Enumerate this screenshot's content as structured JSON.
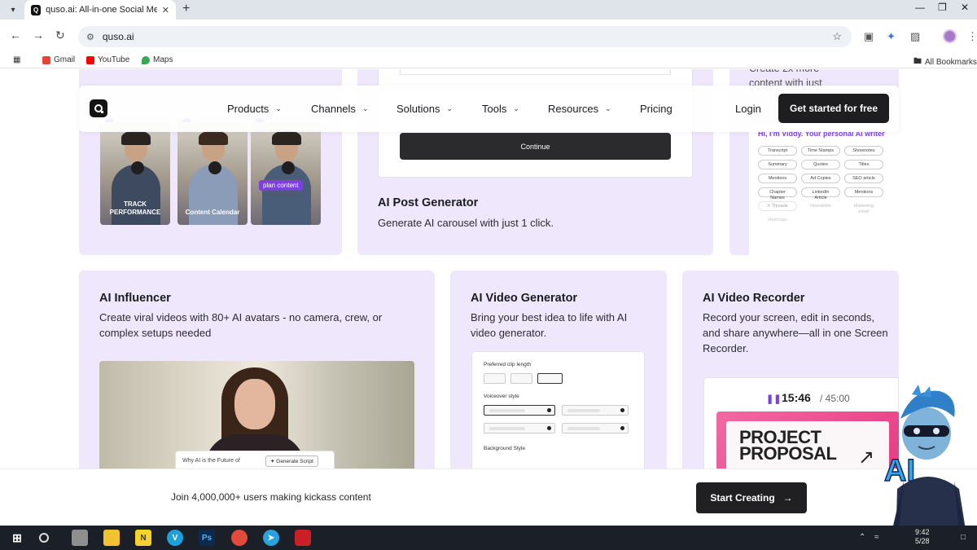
{
  "browser": {
    "tab_title": "quso.ai: All-in-one Social Media",
    "url": "quso.ai",
    "bookmarks": [
      "Gmail",
      "YouTube",
      "Maps"
    ],
    "all_bookmarks": "All Bookmarks"
  },
  "nav": {
    "items": [
      "Products",
      "Channels",
      "Solutions",
      "Tools",
      "Resources"
    ],
    "pricing": "Pricing",
    "login": "Login",
    "cta": "Get started for free"
  },
  "top_row": {
    "photo_captions": [
      "TRACK PERFORMANCE",
      "Content Calendar"
    ],
    "plan_tag": "plan content",
    "continue_label": "Continue",
    "post_generator_title": "AI Post Generator",
    "post_generator_desc": "Generate AI carousel with just 1 click.",
    "c3_top_line1": "Create 2x more",
    "c3_top_line2": "content with just",
    "viddy_text": "Hi, I'm Viddy. Your personal AI writer",
    "chips": [
      "Transcript",
      "Time Stamps",
      "Shownotes",
      "Summary",
      "Quotes",
      "Titles",
      "Mentions",
      "Ad Copies",
      "SEO article",
      "Chapter Names",
      "LinkedIn Article",
      "Mentions",
      "X Threads",
      "Newsletter",
      "Marketing email",
      "Hashtags"
    ]
  },
  "influencer": {
    "title": "AI Influencer",
    "desc": "Create viral videos with 80+ AI avatars - no camera, crew, or complex setups needed",
    "script_question": "Why AI is the Future of",
    "generate_script": "Generate Script"
  },
  "video_generator": {
    "title": "AI Video Generator",
    "desc": "Bring your best idea to life with AI video generator.",
    "clip_length_label": "Preferred clip length",
    "voiceover_label": "Voiceover style",
    "background_label": "Background Style"
  },
  "video_recorder": {
    "title": "AI Video Recorder",
    "desc": "Record your screen, edit in seconds, and share anywhere—all in one Screen Recorder.",
    "time": "15:46",
    "total": "/ 45:00",
    "proposal_line1": "PROJECT",
    "proposal_line2": "PROPOSAL"
  },
  "bottom": {
    "join_text": "Join 4,000,000+ users making kickass content",
    "start_label": "Start Creating"
  },
  "mascot_text": "AI",
  "taskbar": {
    "clock_time": "9:42",
    "clock_date": "5/28"
  }
}
